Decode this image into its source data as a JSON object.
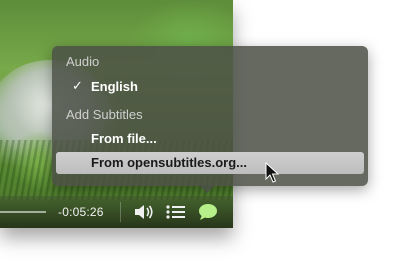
{
  "controls": {
    "time_remaining": "-0:05:26",
    "icons": [
      "volume-icon",
      "playlist-icon",
      "subtitles-icon"
    ]
  },
  "menu": {
    "audio_header": "Audio",
    "audio_items": [
      {
        "label": "English",
        "checked": true
      }
    ],
    "subtitles_header": "Add Subtitles",
    "subtitle_items": [
      {
        "label": "From file..."
      },
      {
        "label": "From opensubtitles.org...",
        "highlighted": true
      }
    ]
  },
  "colors": {
    "menu_bg": "#4c5046",
    "highlight": "#c6c6c6",
    "header_text": "#cfcfcf"
  }
}
